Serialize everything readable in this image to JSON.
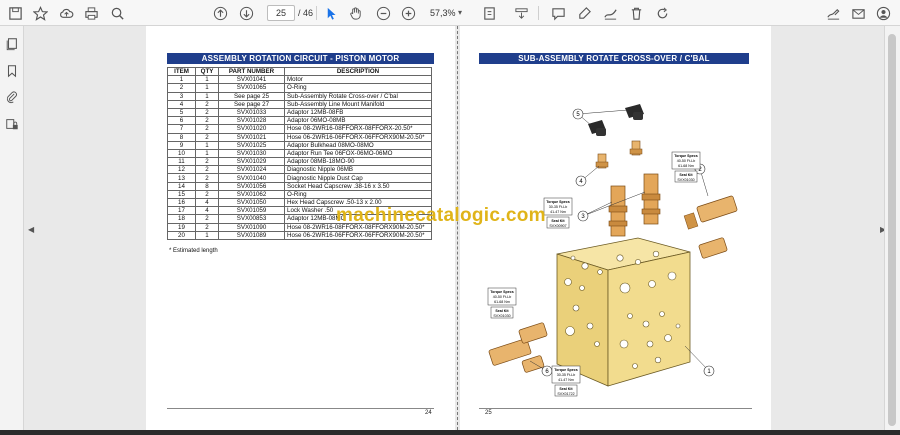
{
  "toolbar": {
    "icons": [
      "save-icon",
      "bookmark-star-icon",
      "cloud-upload-icon",
      "print-icon",
      "zoom-search-icon",
      "page-up-icon",
      "page-down-icon",
      "select-cursor-icon",
      "hand-pan-icon",
      "zoom-out-icon",
      "zoom-in-icon",
      "fit-page-icon",
      "scroll-mode-icon",
      "comment-icon",
      "highlight-pen-icon",
      "draw-icon",
      "delete-icon",
      "rotate-icon",
      "sign-icon",
      "email-icon",
      "account-icon"
    ],
    "current_page": "25",
    "total_pages": "/ 46",
    "zoom": "57,3%"
  },
  "left_panel": {
    "icons": [
      "pages-thumbnail-icon",
      "bookmarks-icon",
      "attachments-icon",
      "layers-lock-icon"
    ]
  },
  "left_page": {
    "title": "ASSEMBLY ROTATION CIRCUIT - PISTON MOTOR",
    "columns": [
      "ITEM",
      "QTY",
      "PART NUMBER",
      "DESCRIPTION"
    ],
    "rows": [
      [
        "1",
        "1",
        "SVX01041",
        "Motor"
      ],
      [
        "2",
        "1",
        "SVX01065",
        "O-Ring"
      ],
      [
        "3",
        "1",
        "See page 25",
        "Sub-Assembly Rotate Cross-over / C'bal"
      ],
      [
        "4",
        "2",
        "See page 27",
        "Sub-Assembly Line Mount Manifold"
      ],
      [
        "5",
        "2",
        "SVX01033",
        "Adaptor 12MB-08FB"
      ],
      [
        "6",
        "2",
        "SVX01028",
        "Adaptor 06MO-08MB"
      ],
      [
        "7",
        "2",
        "SVX01020",
        "Hose 08-2WR16-08FFORX-08FFORX-20.50*"
      ],
      [
        "8",
        "2",
        "SVX01021",
        "Hose 06-2WR16-06FFORX-06FFORX90M-20.50*"
      ],
      [
        "9",
        "1",
        "SVX01025",
        "Adaptor Bulkhead 08MO-08MO"
      ],
      [
        "10",
        "1",
        "SVX01030",
        "Adaptor Run Tee 06FOX-06MO-06MO"
      ],
      [
        "11",
        "2",
        "SVX01029",
        "Adaptor 08MB-18MO-90"
      ],
      [
        "12",
        "2",
        "SVX01024",
        "Diagnostic Nipple 06MB"
      ],
      [
        "13",
        "2",
        "SVX01040",
        "Diagnostic Nipple Dust Cap"
      ],
      [
        "14",
        "8",
        "SVX01056",
        "Socket Head Capscrew .38-16 x 3.50"
      ],
      [
        "15",
        "2",
        "SVX01062",
        "O-Ring"
      ],
      [
        "16",
        "4",
        "SVX01050",
        "Hex Head Capscrew .50-13 x 2.00"
      ],
      [
        "17",
        "4",
        "SVX01059",
        "Lock Washer .50"
      ],
      [
        "18",
        "2",
        "SVX00853",
        "Adaptor 12MB-08MO"
      ],
      [
        "19",
        "2",
        "SVX01090",
        "Hose 08-2WR16-08FFORX-08FFORX90M-20.50*"
      ],
      [
        "20",
        "1",
        "SVX01089",
        "Hose 06-2WR16-06FFORX-06FFORX90M-20.50*"
      ]
    ],
    "footnote": "* Estimated length",
    "page_number": "24"
  },
  "right_page": {
    "title": "SUB-ASSEMBLY ROTATE CROSS-OVER / C'BAL",
    "page_number": "25",
    "callouts": [
      "1",
      "2",
      "3",
      "4",
      "5",
      "6"
    ],
    "spec_boxes": [
      {
        "torque": "Torque Specs",
        "ftlb": "40-50 Ft-Lb",
        "nm": "61-68 Nm",
        "seal": "Seal Kit",
        "kit": "SVX01030"
      },
      {
        "torque": "Torque Specs",
        "ftlb": "30-35 Ft-Lb",
        "nm": "41-47 Nm",
        "seal": "Seal Kit",
        "kit": "SVX00907"
      },
      {
        "torque": "Torque Specs",
        "ftlb": "40-50 Ft-Lb",
        "nm": "61-68 Nm",
        "seal": "Seal Kit",
        "kit": "SVX01030"
      },
      {
        "torque": "Torque Specs",
        "ftlb": "30-35 Ft-Lb",
        "nm": "41-47 Nm",
        "seal": "Seal Kit",
        "kit": "SVX01722"
      }
    ]
  },
  "watermark": "machinecatalogic.com",
  "colors": {
    "banner": "#1f3e8c",
    "manifold": "#f0d98a",
    "valve": "#d9a05a",
    "watermark": "#e0b419"
  }
}
